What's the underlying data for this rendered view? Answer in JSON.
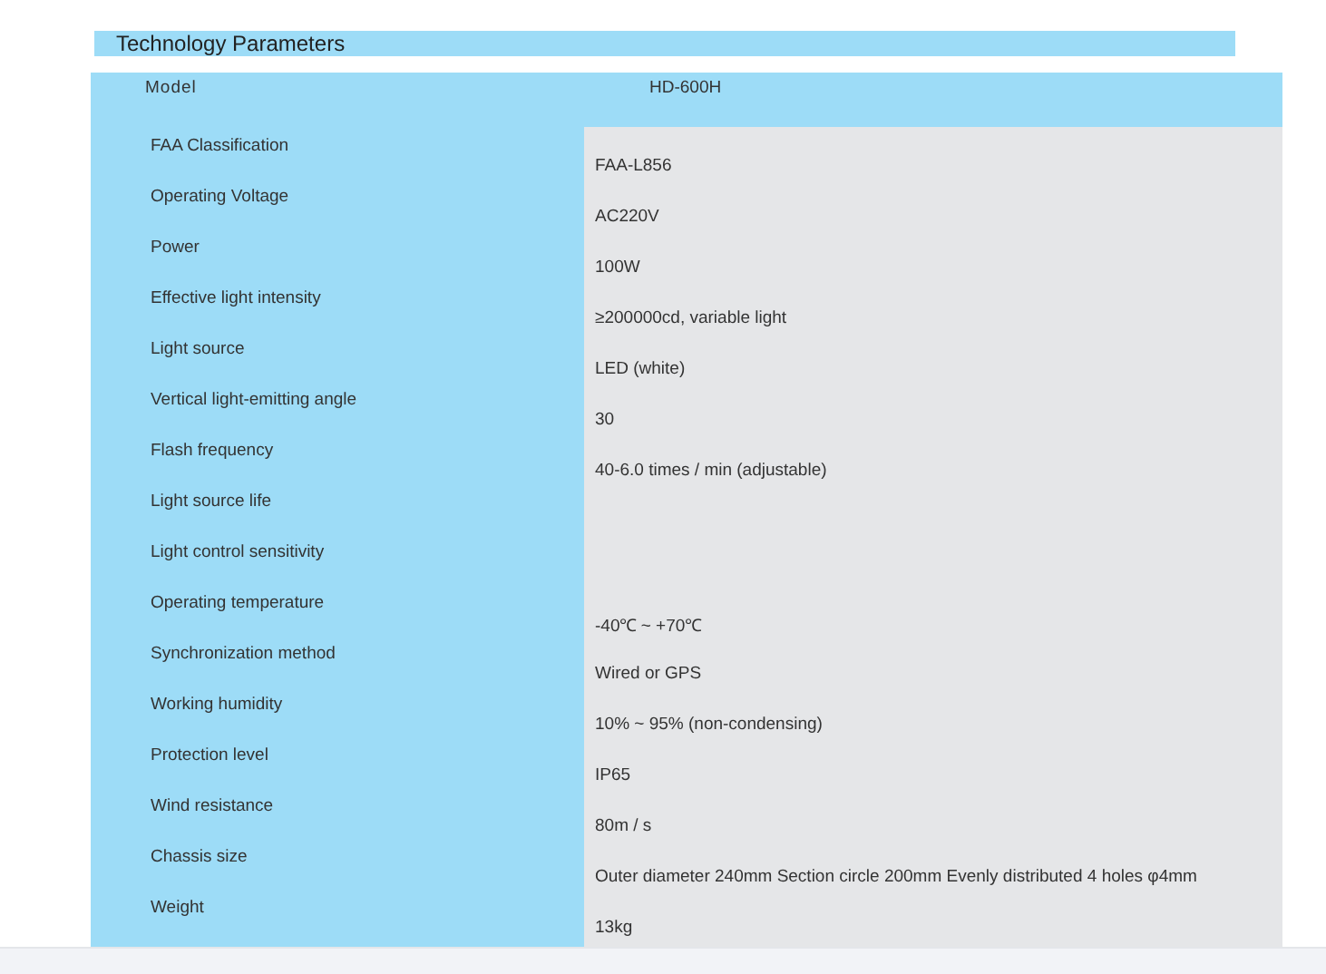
{
  "title": "Technology Parameters",
  "model": {
    "label": "Model",
    "value": "HD-600H"
  },
  "rows": [
    {
      "label": "FAA Classification",
      "value": "FAA-L856"
    },
    {
      "label": "Operating Voltage",
      "value": "AC220V"
    },
    {
      "label": "Power",
      "value": "100W"
    },
    {
      "label": "Effective light intensity",
      "value": "≥200000cd, variable light"
    },
    {
      "label": "Light source",
      "value": "LED (white)"
    },
    {
      "label": "Vertical light-emitting angle",
      "value": "30"
    },
    {
      "label": "Flash frequency",
      "value": "40-6.0 times / min (adjustable)"
    },
    {
      "label": "Light source life"
    },
    {
      "label": "Light control sensitivity"
    },
    {
      "label": "Operating temperature",
      "value": "-40℃ ~ +70℃"
    },
    {
      "label": "Synchronization method",
      "value": "Wired or GPS"
    },
    {
      "label": "Working humidity",
      "value": "10% ~ 95% (non-condensing)"
    },
    {
      "label": "Protection level",
      "value": "IP65"
    },
    {
      "label": "Wind resistance",
      "value": "80m / s"
    },
    {
      "label": "Chassis size",
      "value": "Outer diameter 240mm Section circle 200mm Evenly distributed 4 holes φ4mm"
    },
    {
      "label": "Weight",
      "value": "13kg"
    }
  ]
}
